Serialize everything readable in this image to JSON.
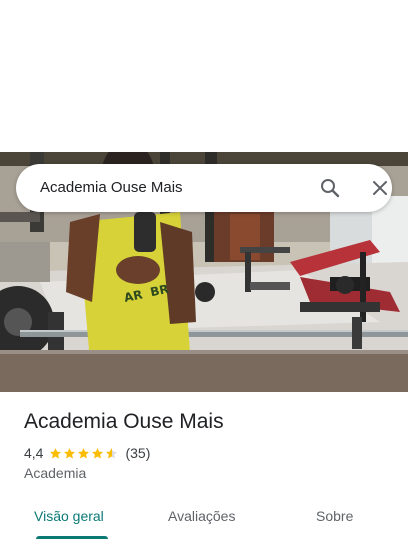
{
  "search": {
    "query": "Academia Ouse Mais",
    "search_icon": "search-icon",
    "close_icon": "close-icon"
  },
  "hero": {
    "photo": "gym-mirror-selfie-photo"
  },
  "place": {
    "name": "Academia Ouse Mais",
    "rating": "4,4",
    "rating_value": 4.4,
    "reviews": "(35)",
    "category": "Academia"
  },
  "tabs": [
    {
      "label": "Visão geral",
      "active": true
    },
    {
      "label": "Avaliações",
      "active": false
    },
    {
      "label": "Sobre",
      "active": false
    }
  ],
  "colors": {
    "accent": "#0b7a75",
    "star": "#fbbc04",
    "star_empty": "#dadce0"
  }
}
